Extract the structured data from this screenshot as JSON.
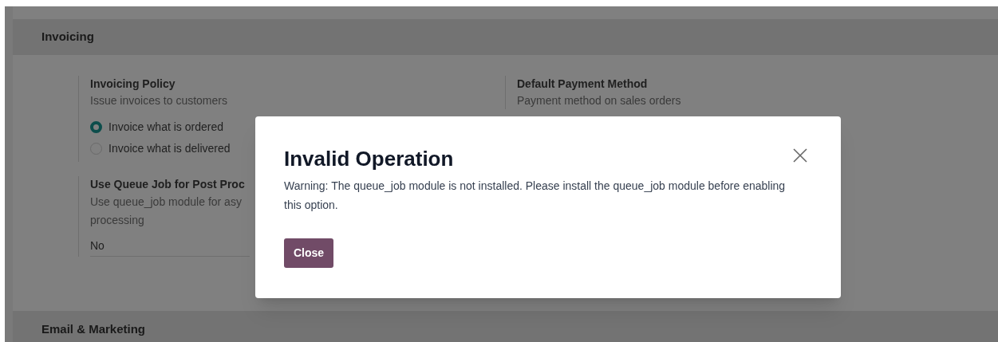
{
  "section": {
    "title": "Invoicing"
  },
  "invoicing_policy": {
    "title": "Invoicing Policy",
    "description": "Issue invoices to customers",
    "options": [
      {
        "label": "Invoice what is ordered",
        "selected": true
      },
      {
        "label": "Invoice what is delivered",
        "selected": false
      }
    ]
  },
  "queue_job": {
    "title": "Use Queue Job for Post Proc",
    "description_lines": [
      "Use queue_job module for asy",
      "processing"
    ],
    "value": "No"
  },
  "default_payment_method": {
    "title": "Default Payment Method",
    "description": "Payment method on sales orders"
  },
  "next_section": {
    "title": "Email & Marketing"
  },
  "dialog": {
    "title": "Invalid Operation",
    "message": "Warning: The queue_job module is not installed. Please install the queue_job module before enabling this option.",
    "button": "Close"
  }
}
